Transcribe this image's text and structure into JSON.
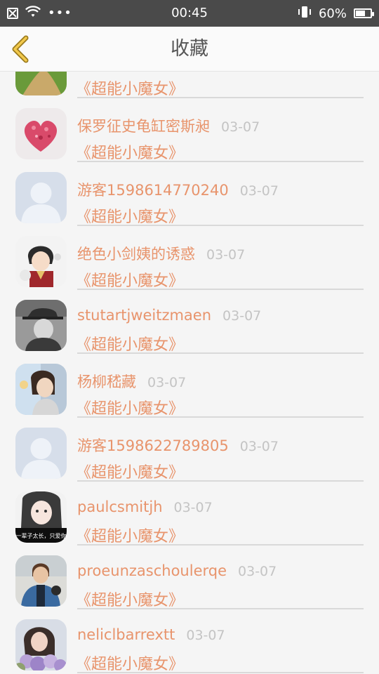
{
  "status_bar": {
    "time": "00:45",
    "dots": "•••",
    "battery": "60%",
    "battery_level": 0.6
  },
  "header": {
    "title": "收藏"
  },
  "items": [
    {
      "name": "",
      "date": "",
      "title": "《超能小魔女》",
      "avatar": "nature"
    },
    {
      "name": "保罗征史龟缸密斯昶",
      "date": "03-07",
      "title": "《超能小魔女》",
      "avatar": "heart"
    },
    {
      "name": "游客1598614770240",
      "date": "03-07",
      "title": "《超能小魔女》",
      "avatar": "default"
    },
    {
      "name": "绝色小剑姨的诱惑",
      "date": "03-07",
      "title": "《超能小魔女》",
      "avatar": "anime"
    },
    {
      "name": "stutartjweitzmaen",
      "date": "03-07",
      "title": "《超能小魔女》",
      "avatar": "man-hat"
    },
    {
      "name": "杨柳嵇藏",
      "date": "03-07",
      "title": "《超能小魔女》",
      "avatar": "woman-side"
    },
    {
      "name": "游客1598622789805",
      "date": "03-07",
      "title": "《超能小魔女》",
      "avatar": "default"
    },
    {
      "name": "paulcsmitjh",
      "date": "03-07",
      "title": "《超能小魔女》",
      "avatar": "girl-caption",
      "avatar_caption": "一辈子太长，只爱你"
    },
    {
      "name": "proeunzaschoulerqe",
      "date": "03-07",
      "title": "《超能小魔女》",
      "avatar": "man-jacket"
    },
    {
      "name": "neliclbarrextt",
      "date": "03-07",
      "title": "《超能小魔女》",
      "avatar": "woman-flowers"
    }
  ]
}
